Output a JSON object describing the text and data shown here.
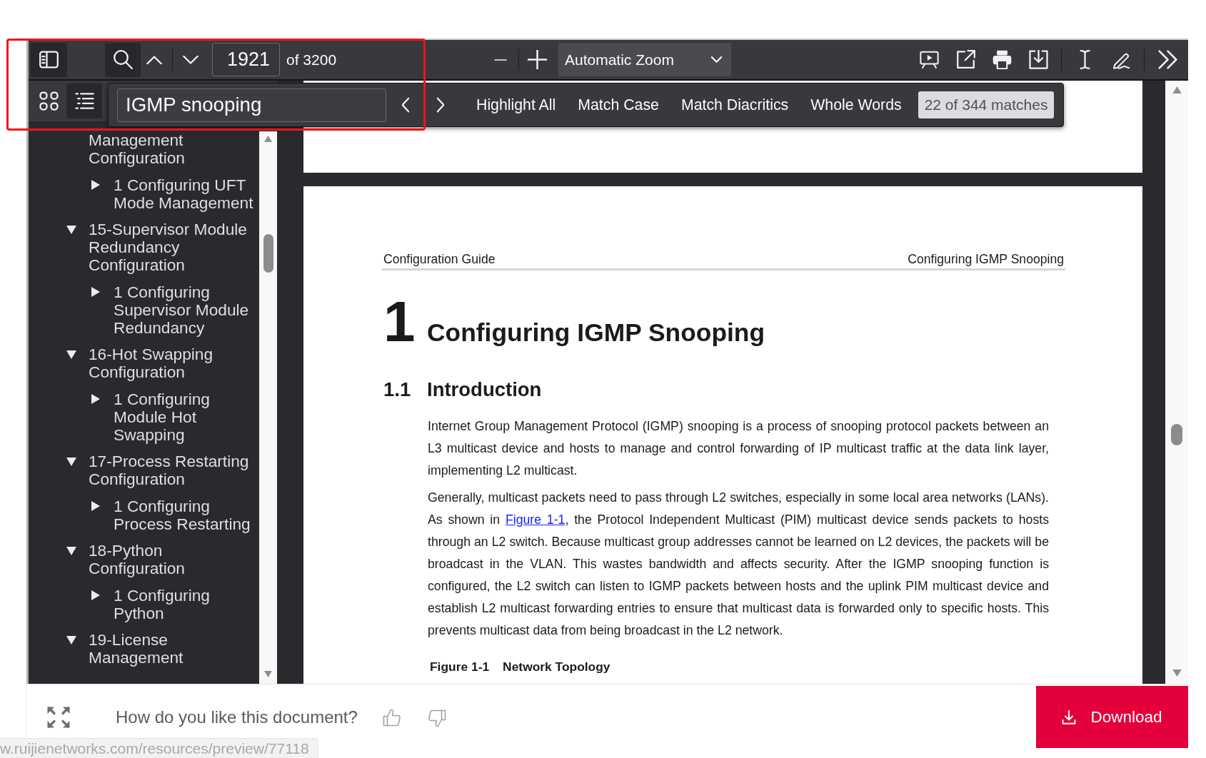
{
  "toolbar": {
    "sidebar_toggle": {
      "selected": true
    },
    "find_button": {
      "selected": true
    },
    "page_number": "1921",
    "page_count": "of 3200",
    "zoom": "Automatic Zoom"
  },
  "sidebar": {
    "views": [
      {
        "kind": "thumbnails",
        "selected": false
      },
      {
        "kind": "outline",
        "selected": true
      }
    ],
    "outline": [
      {
        "label": "Management Configuration",
        "children": [
          {
            "label": "1 Configuring UFT Mode Management",
            "expanded": false
          }
        ]
      },
      {
        "label": "15-Supervisor Module Redundancy Configuration",
        "expanded": true,
        "children": [
          {
            "label": "1 Configuring Supervisor Module Redundancy",
            "expanded": false
          }
        ]
      },
      {
        "label": "16-Hot Swapping Configuration",
        "expanded": true,
        "children": [
          {
            "label": "1 Configuring Module Hot Swapping",
            "expanded": false
          }
        ]
      },
      {
        "label": "17-Process Restarting Configuration",
        "expanded": true,
        "children": [
          {
            "label": "1 Configuring Process Restarting",
            "expanded": false
          }
        ]
      },
      {
        "label": "18-Python Configuration",
        "expanded": true,
        "children": [
          {
            "label": "1 Configuring Python",
            "expanded": false
          }
        ]
      },
      {
        "label": "19-License Management",
        "expanded": true
      }
    ]
  },
  "find_bar": {
    "query": "IGMP snooping",
    "options": [
      "Highlight All",
      "Match Case",
      "Match Diacritics",
      "Whole Words"
    ],
    "result": "22 of 344 matches"
  },
  "page": {
    "header_left": "Configuration Guide",
    "header_right": "Configuring IGMP Snooping",
    "chapter_number": "1",
    "chapter_title": "Configuring IGMP Snooping",
    "section_number": "1.1",
    "section_title": "Introduction",
    "paragraphs": [
      {
        "segments": [
          {
            "kind": "text",
            "text": "Internet Group Management Protocol (IGMP) snooping is a process of snooping protocol packets between an L3 multicast device and hosts to manage and control forwarding of IP multicast traffic at the data link layer, implementing L2 multicast."
          }
        ]
      },
      {
        "segments": [
          {
            "kind": "text",
            "text": "Generally, multicast packets need to pass through L2 switches, especially in some local area networks (LANs). As shown in "
          },
          {
            "kind": "link",
            "text": "Figure 1-1"
          },
          {
            "kind": "text",
            "text": ", the Protocol Independent Multicast (PIM) multicast device sends packets to hosts through an L2 switch. Because multicast group addresses cannot be learned on L2 devices, the packets will be broadcast in the VLAN. This wastes bandwidth and affects security. After the IGMP snooping function is configured, the L2 switch can listen to IGMP packets between hosts and the uplink PIM multicast device and establish L2 multicast forwarding entries to ensure that multicast data is forwarded only to specific hosts. This prevents multicast data from being broadcast in the L2 network."
          }
        ]
      }
    ],
    "figure_caption": {
      "label": "Figure 1-1",
      "title": "Network Topology"
    }
  },
  "feedback_bar": {
    "question": "How do you like this document?",
    "download": "Download"
  },
  "status_url": "w.ruijienetworks.com/resources/preview/77118"
}
